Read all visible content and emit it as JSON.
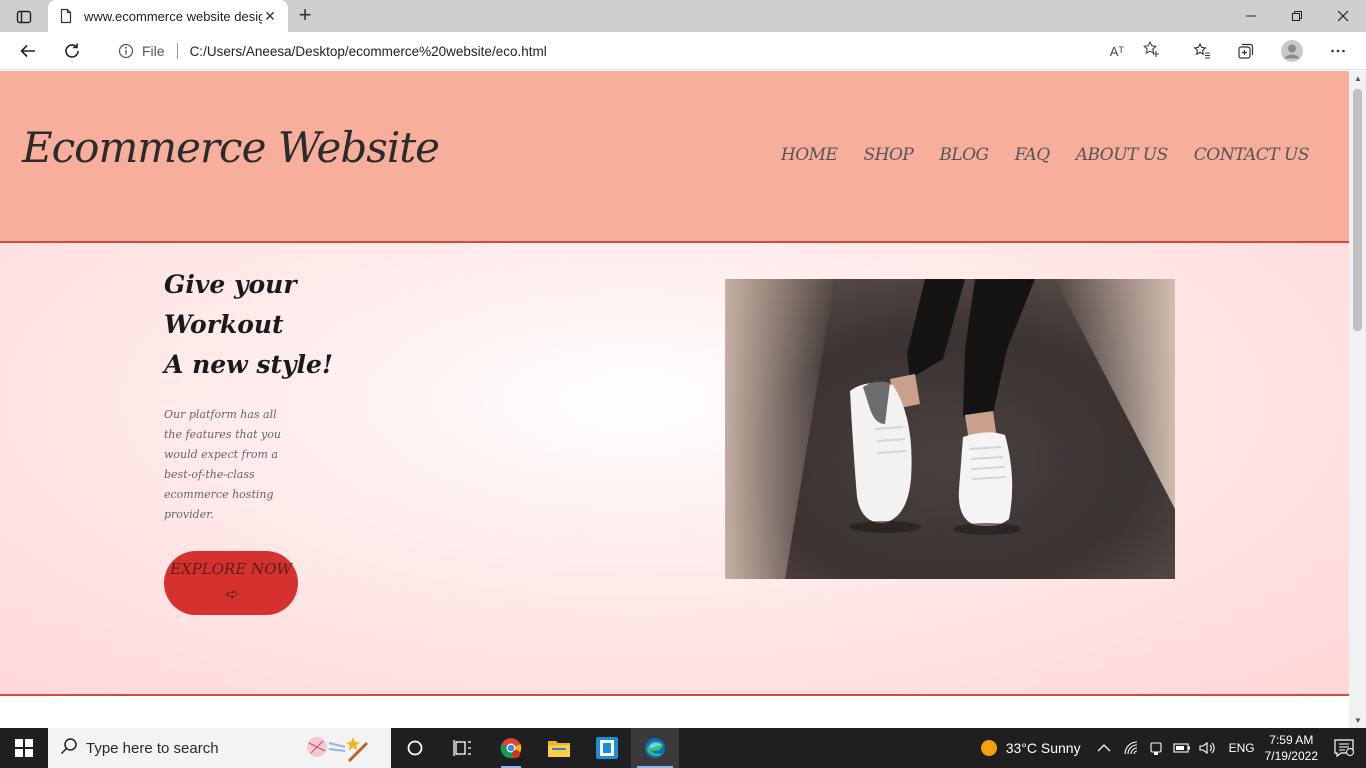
{
  "browser": {
    "tab_title": "www.ecommerce website design",
    "tab_close": "✕",
    "new_tab": "+",
    "file_label": "File",
    "url": "C:/Users/Aneesa/Desktop/ecommerce%20website/eco.html",
    "read_aloud": "Aᵀ"
  },
  "site": {
    "logo": "Ecommerce Website",
    "menu": [
      "HOME",
      "SHOP",
      "BLOG",
      "FAQ",
      "ABOUT US",
      "CONTACT US"
    ]
  },
  "hero": {
    "title_lines": [
      "Give your",
      "Workout",
      "A new style!"
    ],
    "text": "Our platform has all the features that you would expect from a best-of-the-class ecommerce hosting provider.",
    "button_label": "EXPLORE NOW ➪"
  },
  "taskbar": {
    "search_placeholder": "Type here to search",
    "weather": "33°C  Sunny",
    "language": "ENG",
    "time": "7:59 AM",
    "date": "7/19/2022"
  },
  "colors": {
    "header_bg": "#f7ae9b",
    "accent_red": "#d5312e",
    "hero_bg": "#ffd6d6"
  }
}
